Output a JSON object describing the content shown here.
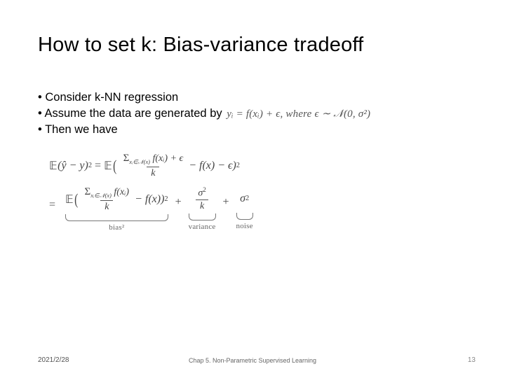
{
  "title": "How to set k: Bias-variance tradeoff",
  "bullets": {
    "b1": "Consider k-NN regression",
    "b2": "Assume the data are generated by",
    "b2_math": "yᵢ = f(xᵢ) + ϵ, where ϵ ∼ 𝒩(0, σ²)",
    "b3": "Then we have"
  },
  "eq": {
    "E": "𝔼",
    "lhs_inner": "(ŷ − y)",
    "sq": "2",
    "sum_text": "Σ",
    "sum_sub": "xᵢ∈𝒩(x)",
    "fxi": "f(xᵢ)",
    "plus_eps": " + ϵ",
    "k": "k",
    "minus_fx": " − f(x) − ϵ)",
    "minus_fx2": " − f(x))",
    "sigma2": "σ",
    "labels": {
      "bias": "bias²",
      "variance": "variance",
      "noise": "noise"
    }
  },
  "footer": {
    "date": "2021/2/28",
    "chapter": "Chap 5. Non-Parametric Supervised Learning",
    "page": "13"
  }
}
